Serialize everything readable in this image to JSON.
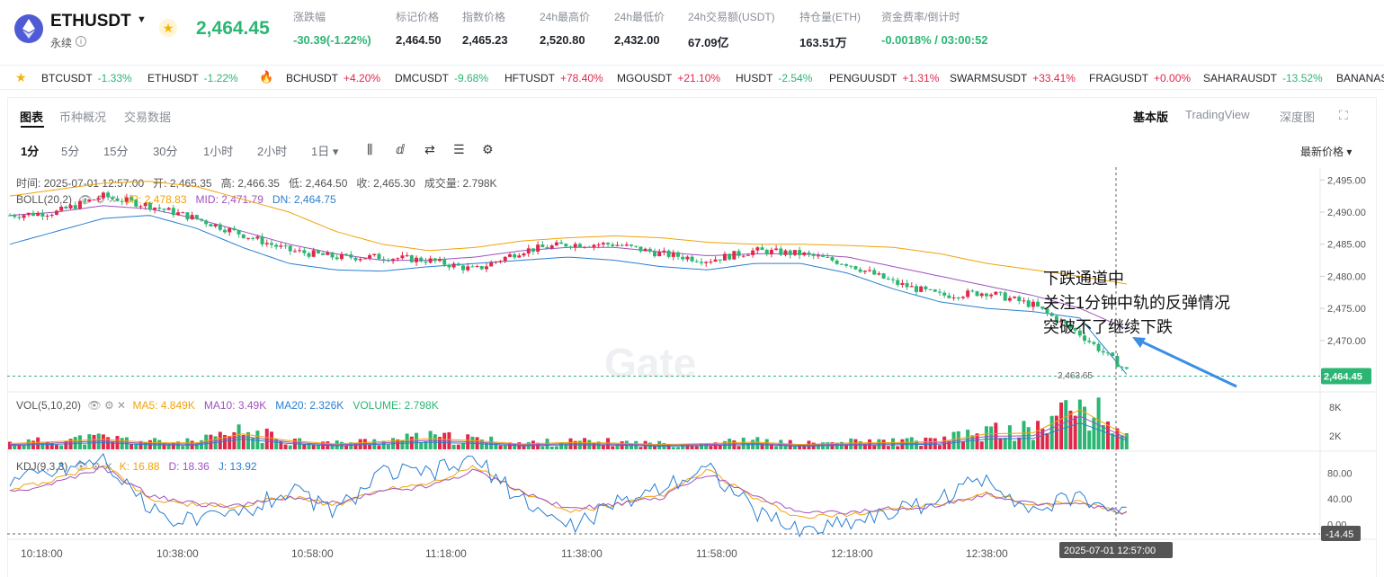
{
  "header": {
    "symbol": "ETHUSDT",
    "contract_type": "永续",
    "last_price": "2,464.45",
    "stats": [
      {
        "label": "涨跌幅",
        "value": "-30.39(-1.22%)",
        "tone": "green"
      },
      {
        "label": "标记价格",
        "value": "2,464.50",
        "tone": "normal"
      },
      {
        "label": "指数价格",
        "value": "2,465.23",
        "tone": "normal"
      },
      {
        "label": "24h最高价",
        "value": "2,520.80",
        "tone": "normal"
      },
      {
        "label": "24h最低价",
        "value": "2,432.00",
        "tone": "normal"
      },
      {
        "label": "24h交易额(USDT)",
        "value": "67.09亿",
        "tone": "normal"
      },
      {
        "label": "持仓量(ETH)",
        "value": "163.51万",
        "tone": "normal"
      },
      {
        "label": "资金费率/倒计时",
        "value": "-0.0018% / 03:00:52",
        "tone": "green"
      }
    ]
  },
  "ticker": [
    {
      "symbol": "BTCUSDT",
      "change": "-1.33%",
      "dir": "dn"
    },
    {
      "symbol": "ETHUSDT",
      "change": "-1.22%",
      "dir": "dn"
    },
    {
      "symbol": "BCHUSDT",
      "change": "+4.20%",
      "dir": "up"
    },
    {
      "symbol": "DMCUSDT",
      "change": "-9.68%",
      "dir": "dn"
    },
    {
      "symbol": "HFTUSDT",
      "change": "+78.40%",
      "dir": "up"
    },
    {
      "symbol": "MGOUSDT",
      "change": "+21.10%",
      "dir": "up"
    },
    {
      "symbol": "HUSDT",
      "change": "-2.54%",
      "dir": "dn"
    },
    {
      "symbol": "PENGUUSDT",
      "change": "+1.31%",
      "dir": "up"
    },
    {
      "symbol": "SWARMSUSDT",
      "change": "+33.41%",
      "dir": "up"
    },
    {
      "symbol": "FRAGUSDT",
      "change": "+0.00%",
      "dir": "up"
    },
    {
      "symbol": "SAHARAUSDT",
      "change": "-13.52%",
      "dir": "dn"
    },
    {
      "symbol": "BANANAS",
      "change": "",
      "dir": "dn"
    }
  ],
  "tabs": [
    "图表",
    "币种概况",
    "交易数据"
  ],
  "view_modes": [
    "基本版",
    "TradingView",
    "深度图"
  ],
  "timeframes": [
    "1分",
    "5分",
    "15分",
    "30分",
    "1小时",
    "2小时",
    "1日 ▾"
  ],
  "price_source": "最新价格 ▾",
  "ohlc_line": {
    "time_label": "时间:",
    "time": "2025-07-01 12:57:00",
    "open_label": "开:",
    "open": "2,465.35",
    "high_label": "高:",
    "high": "2,466.35",
    "low_label": "低:",
    "low": "2,464.50",
    "close_label": "收:",
    "close": "2,465.30",
    "vol_label": "成交量:",
    "vol": "2.798K"
  },
  "indicators": {
    "boll": {
      "name": "BOLL(20,2)",
      "up": "UP: 2,478.83",
      "mid": "MID: 2,471.79",
      "dn": "DN: 2,464.75"
    },
    "vol": {
      "name": "VOL(5,10,20)",
      "ma5": "MA5: 4.849K",
      "ma10": "MA10: 3.49K",
      "ma20": "MA20: 2.326K",
      "volume": "VOLUME: 2.798K"
    },
    "kdj": {
      "name": "KDJ(9,3,3)",
      "k": "K: 16.88",
      "d": "D: 18.36",
      "j": "J: 13.92"
    }
  },
  "annotation": [
    "下跌通道中",
    "关注1分钟中轨的反弹情况",
    "突破不了继续下跌"
  ],
  "price_axis": [
    "2,495.00",
    "2,490.00",
    "2,485.00",
    "2,480.00",
    "2,475.00",
    "2,470.00"
  ],
  "current_price_tag": "2,464.45",
  "low_marker": "2,463.65",
  "vol_axis": [
    "8K",
    "2K"
  ],
  "kdj_axis": [
    "80.00",
    "40.00",
    "0.00"
  ],
  "kdj_current_tag": "-14.45",
  "time_axis": [
    "10:18:00",
    "10:38:00",
    "10:58:00",
    "11:18:00",
    "11:38:00",
    "11:58:00",
    "12:18:00",
    "12:38:00"
  ],
  "crosshair_time": "2025-07-01 12:57:00",
  "colors": {
    "up": "#e0294a",
    "down": "#2bb673",
    "boll_up": "#f0a30a",
    "boll_mid": "#a052c0",
    "boll_dn": "#2a7fd0",
    "kdj_k": "#f0a30a",
    "kdj_d": "#a052c0",
    "kdj_j": "#2a7fd0",
    "vol_ma5": "#f0a30a",
    "vol_ma10": "#a052c0",
    "vol_ma20": "#2a7fd0"
  },
  "chart_data": {
    "type": "candlestick",
    "title": "ETHUSDT 1分",
    "ylim": [
      2462,
      2497
    ],
    "x_ticks": [
      "10:18:00",
      "10:38:00",
      "10:58:00",
      "11:18:00",
      "11:38:00",
      "11:58:00",
      "12:18:00",
      "12:38:00"
    ],
    "series": [
      {
        "name": "BOLL UP",
        "values": [
          2492.5,
          2493.5,
          2494.5,
          2494.8,
          2494,
          2492,
          2490,
          2487,
          2485,
          2484,
          2484.5,
          2485.5,
          2486,
          2486.3,
          2486,
          2485.3,
          2485,
          2485,
          2484.8,
          2484.5,
          2483.5,
          2482,
          2481,
          2480,
          2478.8
        ]
      },
      {
        "name": "BOLL MID",
        "values": [
          2489.5,
          2490,
          2491,
          2490.5,
          2489,
          2487,
          2485,
          2483.5,
          2482.5,
          2482.5,
          2483,
          2484,
          2484.5,
          2484.5,
          2483.8,
          2483.2,
          2483.5,
          2483.5,
          2483,
          2481.5,
          2480,
          2478.5,
          2477,
          2475,
          2471.8
        ]
      },
      {
        "name": "BOLL DN",
        "values": [
          2485,
          2487,
          2489,
          2489.5,
          2487.5,
          2484.5,
          2482,
          2481,
          2480.8,
          2481.5,
          2482,
          2482.5,
          2483,
          2482.5,
          2481.5,
          2481,
          2482,
          2482,
          2480.5,
          2478,
          2476,
          2475,
          2474.5,
          2473.5,
          2464.75
        ]
      },
      {
        "name": "close",
        "values": [
          2489.5,
          2490,
          2492.5,
          2491,
          2489,
          2486.5,
          2484,
          2483,
          2483,
          2482.5,
          2481,
          2484,
          2485,
          2485,
          2483.5,
          2482.5,
          2484,
          2483.5,
          2482,
          2479,
          2477,
          2477.5,
          2475.5,
          2471,
          2465.3
        ]
      },
      {
        "name": "VOL",
        "values": [
          1.2,
          1.6,
          2.1,
          1.4,
          1.3,
          3.2,
          1.8,
          1.1,
          1.6,
          2.2,
          1.8,
          1.1,
          1.4,
          1.3,
          1.0,
          1.2,
          1.5,
          1.0,
          1.3,
          1.4,
          1.6,
          3.2,
          3.4,
          8.2,
          2.8
        ]
      },
      {
        "name": "K",
        "values": [
          55,
          70,
          95,
          40,
          30,
          28,
          45,
          30,
          55,
          65,
          90,
          50,
          20,
          30,
          45,
          85,
          40,
          10,
          15,
          25,
          30,
          50,
          30,
          35,
          16.88
        ]
      },
      {
        "name": "D",
        "values": [
          50,
          65,
          88,
          45,
          32,
          30,
          42,
          33,
          52,
          60,
          85,
          52,
          25,
          30,
          42,
          80,
          45,
          18,
          18,
          25,
          30,
          45,
          32,
          33,
          18.36
        ]
      },
      {
        "name": "J",
        "values": [
          70,
          85,
          105,
          20,
          5,
          20,
          55,
          20,
          80,
          80,
          100,
          40,
          -5,
          30,
          60,
          90,
          20,
          -10,
          5,
          20,
          40,
          75,
          20,
          45,
          13.92
        ]
      }
    ]
  }
}
